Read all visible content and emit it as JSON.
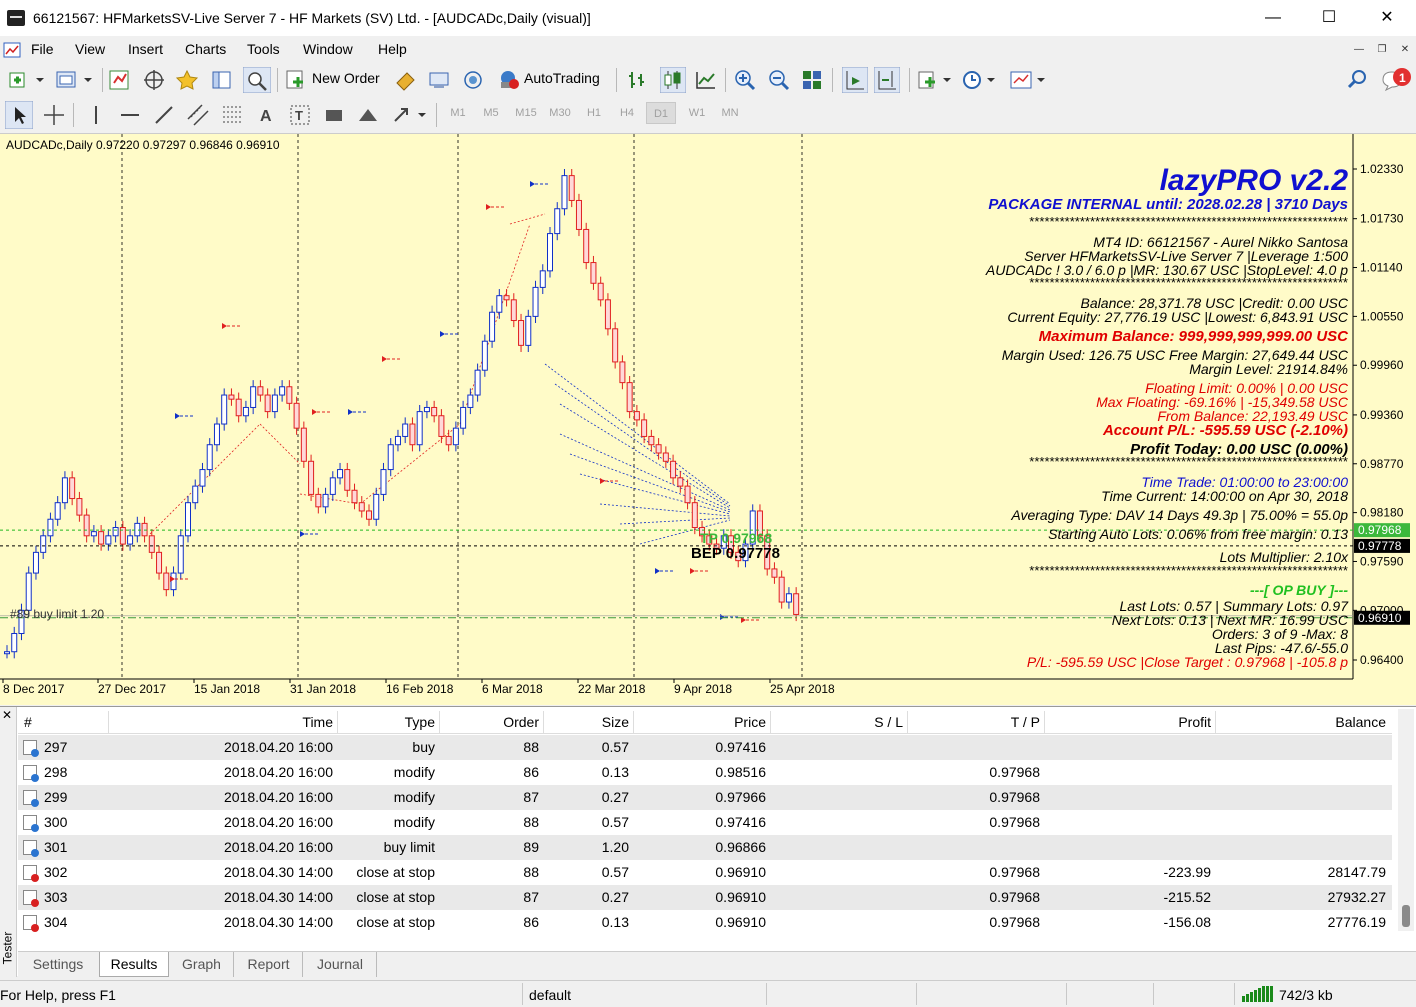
{
  "window": {
    "title": "66121567: HFMarketsSV-Live Server 7 - HF Markets (SV) Ltd. - [AUDCADc,Daily (visual)]"
  },
  "menu": [
    "File",
    "View",
    "Insert",
    "Charts",
    "Tools",
    "Window",
    "Help"
  ],
  "toolbar": {
    "new_order": "New Order",
    "autotrading": "AutoTrading",
    "notification_count": "1"
  },
  "timeframes": [
    "M1",
    "M5",
    "M15",
    "M30",
    "H1",
    "H4",
    "D1",
    "W1",
    "MN"
  ],
  "active_timeframe": "D1",
  "chart": {
    "symbol_info": "AUDCADc,Daily  0.97220 0.97297 0.96846 0.96910",
    "price_ticks": [
      "1.02330",
      "1.01730",
      "1.01140",
      "1.00550",
      "0.99960",
      "0.99360",
      "0.98770",
      "0.98180",
      "0.97590",
      "0.97000",
      "0.96400"
    ],
    "date_ticks": [
      "8 Dec 2017",
      "27 Dec 2017",
      "15 Jan 2018",
      "31 Jan 2018",
      "16 Feb 2018",
      "6 Mar 2018",
      "22 Mar 2018",
      "9 Apr 2018",
      "25 Apr 2018"
    ],
    "price_tags": {
      "tp": "0.97968",
      "bep": "0.97778",
      "current": "0.96910"
    },
    "tp_label": "TP 0.97968",
    "bep_label": "BEP 0.97778",
    "limit_label": "#89 buy limit 1.20",
    "colors": {
      "background": "#fffbc8",
      "bull": "#1030c8",
      "bear": "#e02020",
      "tp_line": "#20b820",
      "tp_tag": "#3cb83c",
      "price_tag": "#000000"
    }
  },
  "panel": {
    "title": "lazyPRO v2.2",
    "package": "PACKAGE INTERNAL until: 2028.02.28 | 3710 Days",
    "stars": "***************************************************************",
    "mt4_id": "MT4 ID: 66121567 - Aurel Nikko Santosa",
    "server": "Server HFMarketsSV-Live Server 7 |Leverage 1:500",
    "symbol": "AUDCADc ! 3.0 / 6.0 p |MR: 130.67 USC |StopLevel: 4.0 p",
    "balance": "Balance: 28,371.78 USC |Credit: 0.00 USC",
    "equity": "Current Equity: 27,776.19 USC |Lowest: 6,843.91 USC",
    "max_balance": "Maximum Balance: 999,999,999,999.00 USC",
    "margin_used": "Margin Used: 126.75 USC Free Margin: 27,649.44 USC",
    "margin_level": "Margin Level: 21914.84%",
    "floating_limit": "Floating Limit: 0.00% | 0.00 USC",
    "max_floating": "Max Floating: -69.16% | -15,349.58 USC",
    "from_balance": "From Balance: 22,193.49 USC",
    "account_pl": "Account P/L: -595.59 USC (-2.10%)",
    "profit_today": "Profit Today: 0.00 USC (0.00%)",
    "time_trade": "Time Trade: 01:00:00 to 23:00:00",
    "time_current": "Time Current: 14:00:00 on Apr 30, 2018",
    "averaging": "Averaging Type: DAV 14 Days 49.3p | 75.00% = 55.0p",
    "starting_lots": "Starting Auto Lots: 0.06% from free margin: 0.13",
    "lots_multiplier": "Lots Multiplier: 2.10x",
    "op_buy": "---[ OP BUY ]---",
    "last_lots": "Last Lots: 0.57 | Summary Lots: 0.97",
    "next_lots": "Next Lots: 0.13 | Next MR: 16.99 USC",
    "orders": "Orders: 3 of 9 -Max: 8",
    "last_pips": "Last Pips: -47.6/-55.0",
    "pl_target": "P/L: -595.59 USC |Close Target : 0.97968 | -105.8 p"
  },
  "table": {
    "headers": [
      "#",
      "Time",
      "Type",
      "Order",
      "Size",
      "Price",
      "S / L",
      "T / P",
      "Profit",
      "Balance"
    ],
    "rows": [
      [
        "297",
        "2018.04.20 16:00",
        "buy",
        "88",
        "0.57",
        "0.97416",
        "",
        "",
        "",
        ""
      ],
      [
        "298",
        "2018.04.20 16:00",
        "modify",
        "86",
        "0.13",
        "0.98516",
        "",
        "0.97968",
        "",
        ""
      ],
      [
        "299",
        "2018.04.20 16:00",
        "modify",
        "87",
        "0.27",
        "0.97966",
        "",
        "0.97968",
        "",
        ""
      ],
      [
        "300",
        "2018.04.20 16:00",
        "modify",
        "88",
        "0.57",
        "0.97416",
        "",
        "0.97968",
        "",
        ""
      ],
      [
        "301",
        "2018.04.20 16:00",
        "buy limit",
        "89",
        "1.20",
        "0.96866",
        "",
        "",
        "",
        ""
      ],
      [
        "302",
        "2018.04.30 14:00",
        "close at stop",
        "88",
        "0.57",
        "0.96910",
        "",
        "0.97968",
        "-223.99",
        "28147.79"
      ],
      [
        "303",
        "2018.04.30 14:00",
        "close at stop",
        "87",
        "0.27",
        "0.96910",
        "",
        "0.97968",
        "-215.52",
        "27932.27"
      ],
      [
        "304",
        "2018.04.30 14:00",
        "close at stop",
        "86",
        "0.13",
        "0.96910",
        "",
        "0.97968",
        "-156.08",
        "27776.19"
      ]
    ]
  },
  "tester_label": "Tester",
  "tabs": [
    "Settings",
    "Results",
    "Graph",
    "Report",
    "Journal"
  ],
  "active_tab": "Results",
  "status": {
    "help": "For Help, press F1",
    "profile": "default",
    "traffic": "742/3 kb"
  }
}
